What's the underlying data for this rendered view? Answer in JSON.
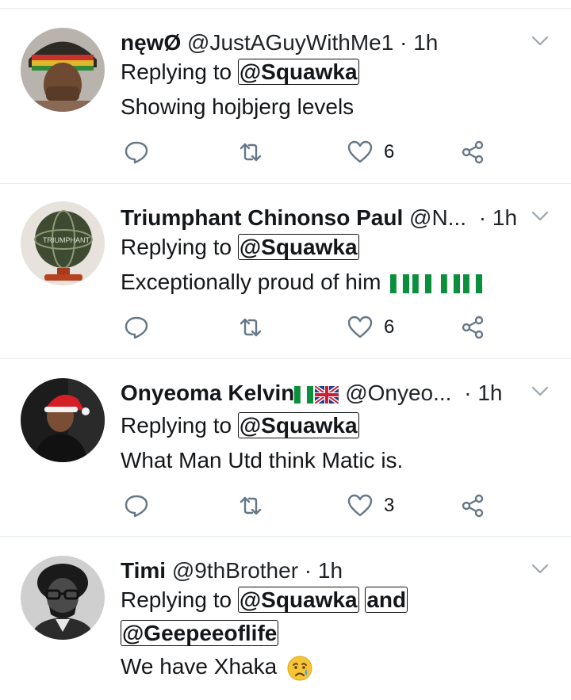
{
  "tweets": [
    {
      "display_name": "nęwØ",
      "handle": "@JustAGuyWithMe1",
      "dot": "·",
      "time": "1h",
      "reply_prefix": "Replying to",
      "mentions": [
        "@Squawka"
      ],
      "reply_joiner": "",
      "text": "Showing hojbjerg levels",
      "likes": "6",
      "avatar": "avatar-rasta-cap"
    },
    {
      "display_name": "Triumphant Chinonso Paul",
      "handle": "@N...",
      "dot": "·",
      "time": "1h",
      "reply_prefix": "Replying to",
      "mentions": [
        "@Squawka"
      ],
      "reply_joiner": "",
      "text": "Exceptionally proud of him",
      "likes": "6",
      "avatar": "avatar-globe",
      "avatar_text": "TRIUMPHANT"
    },
    {
      "display_name": "Onyeoma Kelvin",
      "handle": "@Onyeo...",
      "dot": "·",
      "time": "1h",
      "reply_prefix": "Replying to",
      "mentions": [
        "@Squawka"
      ],
      "reply_joiner": "",
      "text": "What Man Utd think Matic is.",
      "likes": "3",
      "avatar": "avatar-santa-hat"
    },
    {
      "display_name": "Timi",
      "handle": "@9thBrother",
      "dot": "·",
      "time": "1h",
      "reply_prefix": "Replying to",
      "mentions": [
        "@Squawka",
        "@Geepeeoflife"
      ],
      "reply_joiner": "and",
      "text": "We have Xhaka",
      "avatar": "avatar-bw-portrait"
    }
  ],
  "icons": {
    "reply": "reply-icon",
    "retweet": "retweet-icon",
    "like": "heart-icon",
    "share": "share-icon",
    "menu": "chevron-down-icon"
  },
  "colors": {
    "icon_gray": "#657786",
    "divider": "#e6ecf0",
    "nigeria_green": "#0a8f3c",
    "uk_blue": "#1f3f8a",
    "uk_red": "#cc1f36"
  }
}
